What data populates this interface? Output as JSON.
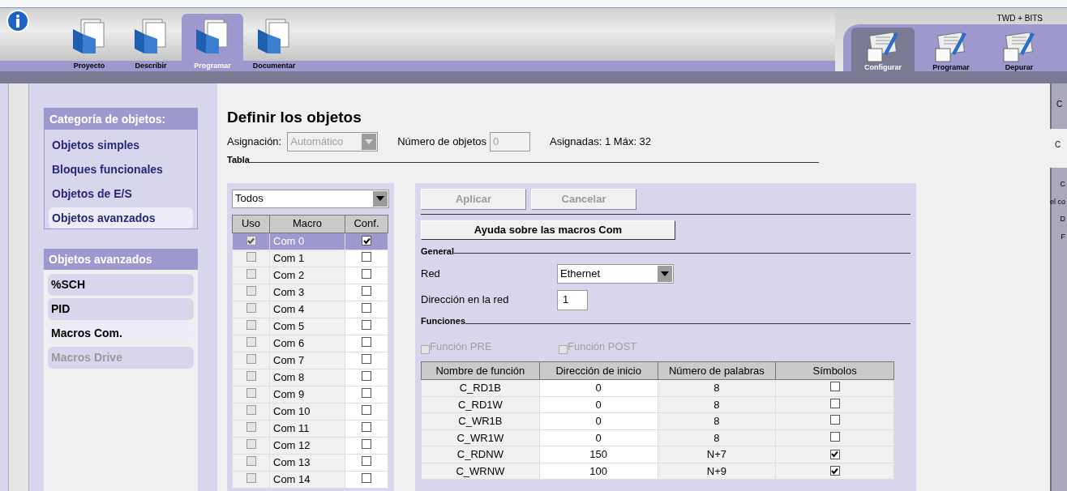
{
  "main_tabs": [
    {
      "label": "Proyecto",
      "selected": false
    },
    {
      "label": "Describir",
      "selected": false
    },
    {
      "label": "Programar",
      "selected": true
    },
    {
      "label": "Documentar",
      "selected": false
    }
  ],
  "profile": "TWD + BITS",
  "mode_tabs": [
    {
      "label": "Configurar",
      "selected": true
    },
    {
      "label": "Programar",
      "selected": false
    },
    {
      "label": "Depurar",
      "selected": false
    }
  ],
  "category_panel": {
    "title": "Categoría de objetos:",
    "items": [
      {
        "label": "Objetos simples",
        "selected": false
      },
      {
        "label": "Bloques funcionales",
        "selected": false
      },
      {
        "label": "Objetos de E/S",
        "selected": false
      },
      {
        "label": "Objetos avanzados",
        "selected": true
      }
    ]
  },
  "advanced_panel": {
    "title": "Objetos avanzados",
    "items": [
      {
        "label": "%SCH",
        "selected": false,
        "disabled": false
      },
      {
        "label": "PID",
        "selected": false,
        "disabled": false
      },
      {
        "label": "Macros Com.",
        "selected": true,
        "disabled": false
      },
      {
        "label": "Macros Drive",
        "selected": false,
        "disabled": true
      }
    ]
  },
  "page_title": "Definir los objetos",
  "assignment": {
    "label": "Asignación:",
    "value": "Automático",
    "disabled": true
  },
  "object_count": {
    "label": "Número de objetos",
    "value": "0",
    "disabled": true
  },
  "assigned_info": "Asignadas: 1 Máx: 32",
  "table_section": "Tabla",
  "macro_filter": "Todos",
  "macro_table": {
    "columns": [
      "Uso",
      "Macro",
      "Conf."
    ],
    "rows": [
      {
        "macro": "Com 0",
        "used": true,
        "configured": true,
        "selected": true
      },
      {
        "macro": "Com 1",
        "used": false,
        "configured": false,
        "selected": false
      },
      {
        "macro": "Com 2",
        "used": false,
        "configured": false,
        "selected": false
      },
      {
        "macro": "Com 3",
        "used": false,
        "configured": false,
        "selected": false
      },
      {
        "macro": "Com 4",
        "used": false,
        "configured": false,
        "selected": false
      },
      {
        "macro": "Com 5",
        "used": false,
        "configured": false,
        "selected": false
      },
      {
        "macro": "Com 6",
        "used": false,
        "configured": false,
        "selected": false
      },
      {
        "macro": "Com 7",
        "used": false,
        "configured": false,
        "selected": false
      },
      {
        "macro": "Com 8",
        "used": false,
        "configured": false,
        "selected": false
      },
      {
        "macro": "Com 9",
        "used": false,
        "configured": false,
        "selected": false
      },
      {
        "macro": "Com 10",
        "used": false,
        "configured": false,
        "selected": false
      },
      {
        "macro": "Com 11",
        "used": false,
        "configured": false,
        "selected": false
      },
      {
        "macro": "Com 12",
        "used": false,
        "configured": false,
        "selected": false
      },
      {
        "macro": "Com 13",
        "used": false,
        "configured": false,
        "selected": false
      },
      {
        "macro": "Com 14",
        "used": false,
        "configured": false,
        "selected": false
      }
    ]
  },
  "buttons": [
    {
      "label": "Aplicar",
      "disabled": true
    },
    {
      "label": "Cancelar",
      "disabled": true
    }
  ],
  "help_button": "Ayuda sobre las macros Com",
  "general_section": "General",
  "network": {
    "label": "Red",
    "value": "Ethernet"
  },
  "address": {
    "label": "Dirección en la red",
    "value": "1"
  },
  "functions_section": "Funciones",
  "function_options": [
    {
      "label": "Función PRE",
      "checked": false,
      "disabled": true
    },
    {
      "label": "Función POST",
      "checked": false,
      "disabled": true
    }
  ],
  "function_table": {
    "columns": [
      "Nombre de función",
      "Dirección de inicio",
      "Número de palabras",
      "Símbolos"
    ],
    "rows": [
      {
        "name": "C_RD1B",
        "start": "0",
        "words": "8",
        "symbols": false
      },
      {
        "name": "C_RD1W",
        "start": "0",
        "words": "8",
        "symbols": false
      },
      {
        "name": "C_WR1B",
        "start": "0",
        "words": "8",
        "symbols": false
      },
      {
        "name": "C_WR1W",
        "start": "0",
        "words": "8",
        "symbols": false
      },
      {
        "name": "C_RDNW",
        "start": "150",
        "words": "N+7",
        "symbols": true
      },
      {
        "name": "C_WRNW",
        "start": "100",
        "words": "N+9",
        "symbols": true
      }
    ]
  },
  "side_fragments": {
    "top": [
      "C"
    ],
    "middle": [
      "C"
    ],
    "bottom": [
      "C",
      "el co",
      "D",
      "F"
    ]
  }
}
